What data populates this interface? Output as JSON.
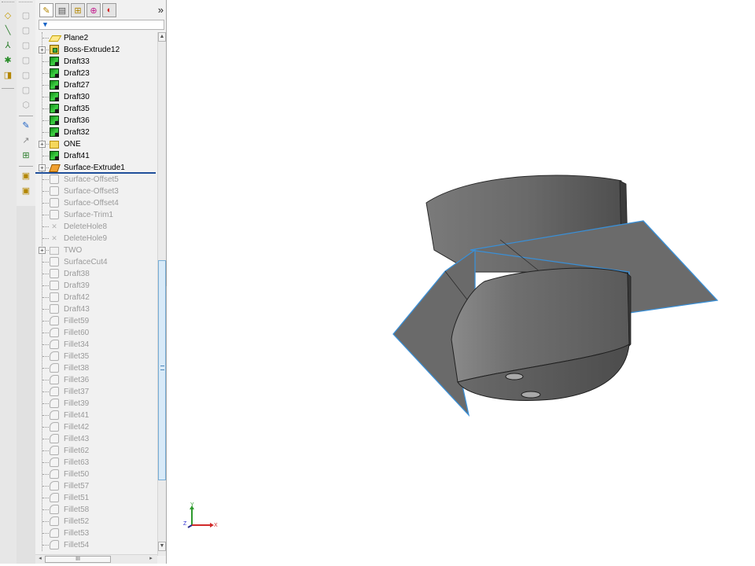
{
  "command_toolbar": {
    "icons": [
      "plane-icon",
      "axis-icon",
      "coordinate-system-icon",
      "point-icon",
      "mate-reference-icon"
    ]
  },
  "view_toolbar": {
    "icons": [
      "front-view-icon",
      "back-view-icon",
      "left-view-icon",
      "right-view-icon",
      "top-view-icon",
      "bottom-view-icon",
      "isometric-view-icon",
      "sketch-icon",
      "smart-dimension-icon",
      "relations-icon",
      "insert-component-icon",
      "instant3d-icon"
    ]
  },
  "feature_manager": {
    "tabs": [
      "feature-manager-tab",
      "property-manager-tab",
      "configuration-manager-tab",
      "dimxpert-tab",
      "display-manager-tab"
    ],
    "more_label": "»",
    "filter_icon": "filter-icon",
    "items": [
      {
        "label": "Plane2",
        "icon": "plane",
        "expander": false,
        "suppressed": false
      },
      {
        "label": "Boss-Extrude12",
        "icon": "boss",
        "expander": true,
        "suppressed": false
      },
      {
        "label": "Draft33",
        "icon": "draft",
        "expander": false,
        "suppressed": false
      },
      {
        "label": "Draft23",
        "icon": "draft",
        "expander": false,
        "suppressed": false
      },
      {
        "label": "Draft27",
        "icon": "draft",
        "expander": false,
        "suppressed": false
      },
      {
        "label": "Draft30",
        "icon": "draft",
        "expander": false,
        "suppressed": false
      },
      {
        "label": "Draft35",
        "icon": "draft",
        "expander": false,
        "suppressed": false
      },
      {
        "label": "Draft36",
        "icon": "draft",
        "expander": false,
        "suppressed": false
      },
      {
        "label": "Draft32",
        "icon": "draft",
        "expander": false,
        "suppressed": false
      },
      {
        "label": "ONE",
        "icon": "folder",
        "expander": true,
        "suppressed": false
      },
      {
        "label": "Draft41",
        "icon": "draft",
        "expander": false,
        "suppressed": false
      },
      {
        "label": "Surface-Extrude1",
        "icon": "surface",
        "expander": true,
        "suppressed": false
      },
      {
        "label": "Surface-Offset5",
        "icon": "dim",
        "expander": false,
        "suppressed": true
      },
      {
        "label": "Surface-Offset3",
        "icon": "dim",
        "expander": false,
        "suppressed": true
      },
      {
        "label": "Surface-Offset4",
        "icon": "dim",
        "expander": false,
        "suppressed": true
      },
      {
        "label": "Surface-Trim1",
        "icon": "dim",
        "expander": false,
        "suppressed": true
      },
      {
        "label": "DeleteHole8",
        "icon": "hole",
        "expander": false,
        "suppressed": true
      },
      {
        "label": "DeleteHole9",
        "icon": "hole",
        "expander": false,
        "suppressed": true
      },
      {
        "label": "TWO",
        "icon": "folder",
        "expander": true,
        "suppressed": true
      },
      {
        "label": "SurfaceCut4",
        "icon": "dim",
        "expander": false,
        "suppressed": true
      },
      {
        "label": "Draft38",
        "icon": "dim",
        "expander": false,
        "suppressed": true
      },
      {
        "label": "Draft39",
        "icon": "dim",
        "expander": false,
        "suppressed": true
      },
      {
        "label": "Draft42",
        "icon": "dim",
        "expander": false,
        "suppressed": true
      },
      {
        "label": "Draft43",
        "icon": "dim",
        "expander": false,
        "suppressed": true
      },
      {
        "label": "Fillet59",
        "icon": "fillet",
        "expander": false,
        "suppressed": true
      },
      {
        "label": "Fillet60",
        "icon": "fillet",
        "expander": false,
        "suppressed": true
      },
      {
        "label": "Fillet34",
        "icon": "fillet",
        "expander": false,
        "suppressed": true
      },
      {
        "label": "Fillet35",
        "icon": "fillet",
        "expander": false,
        "suppressed": true
      },
      {
        "label": "Fillet38",
        "icon": "fillet",
        "expander": false,
        "suppressed": true
      },
      {
        "label": "Fillet36",
        "icon": "fillet",
        "expander": false,
        "suppressed": true
      },
      {
        "label": "Fillet37",
        "icon": "fillet",
        "expander": false,
        "suppressed": true
      },
      {
        "label": "Fillet39",
        "icon": "fillet",
        "expander": false,
        "suppressed": true
      },
      {
        "label": "Fillet41",
        "icon": "fillet",
        "expander": false,
        "suppressed": true
      },
      {
        "label": "Fillet42",
        "icon": "fillet",
        "expander": false,
        "suppressed": true
      },
      {
        "label": "Fillet43",
        "icon": "fillet",
        "expander": false,
        "suppressed": true
      },
      {
        "label": "Fillet62",
        "icon": "fillet",
        "expander": false,
        "suppressed": true
      },
      {
        "label": "Fillet63",
        "icon": "fillet",
        "expander": false,
        "suppressed": true
      },
      {
        "label": "Fillet50",
        "icon": "fillet",
        "expander": false,
        "suppressed": true
      },
      {
        "label": "Fillet57",
        "icon": "fillet",
        "expander": false,
        "suppressed": true
      },
      {
        "label": "Fillet51",
        "icon": "fillet",
        "expander": false,
        "suppressed": true
      },
      {
        "label": "Fillet58",
        "icon": "fillet",
        "expander": false,
        "suppressed": true
      },
      {
        "label": "Fillet52",
        "icon": "fillet",
        "expander": false,
        "suppressed": true
      },
      {
        "label": "Fillet53",
        "icon": "fillet",
        "expander": false,
        "suppressed": true
      },
      {
        "label": "Fillet54",
        "icon": "fillet",
        "expander": false,
        "suppressed": true
      }
    ],
    "rollback_bar_after": "Surface-Extrude1"
  },
  "scrollbar": {
    "hthumb_label": "III"
  },
  "viewport": {
    "background": "#ffffff",
    "model_color": "#6b6b6b",
    "edge_highlight_color": "#3a8fd6",
    "triad": {
      "x_label": "X",
      "y_label": "Y",
      "z_label": "Z",
      "x_color": "#d12a2a",
      "y_color": "#2e9a2e",
      "z_color": "#2a2ad1"
    }
  },
  "colors": {
    "rollback_bar": "#1f4f9a",
    "suppressed_text": "#9a9a9a"
  }
}
